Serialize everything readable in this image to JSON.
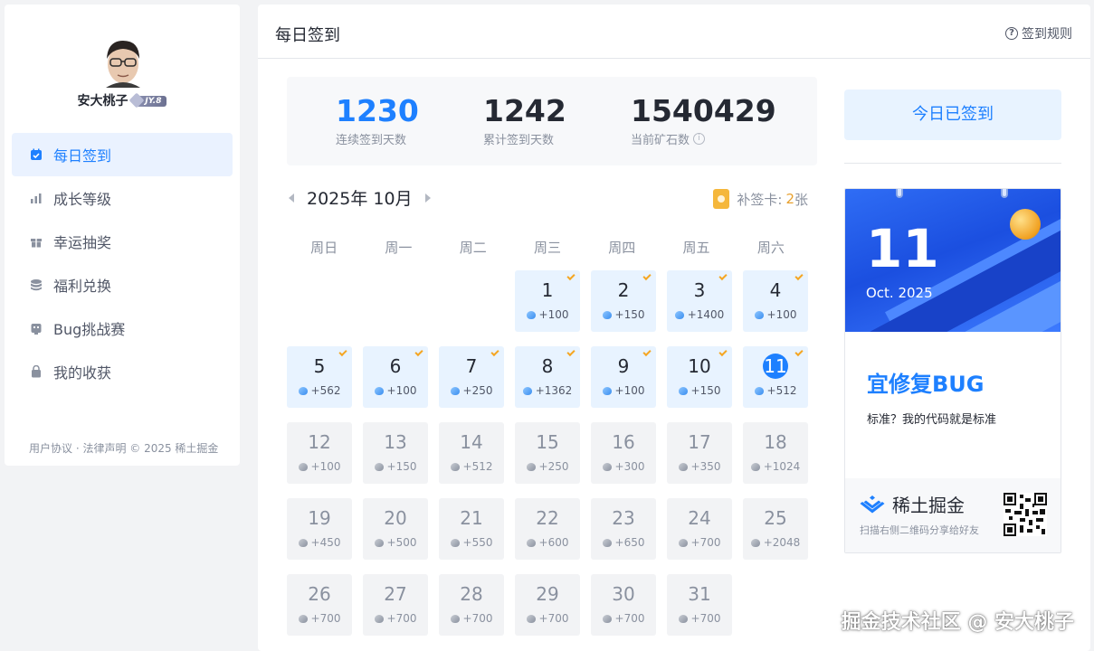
{
  "user": {
    "name": "安大桃子",
    "level": "JY.8"
  },
  "nav": [
    {
      "label": "每日签到",
      "icon": "calendar-check-icon",
      "active": true
    },
    {
      "label": "成长等级",
      "icon": "bar-chart-icon",
      "active": false
    },
    {
      "label": "幸运抽奖",
      "icon": "gift-icon",
      "active": false
    },
    {
      "label": "福利兑换",
      "icon": "coins-icon",
      "active": false
    },
    {
      "label": "Bug挑战赛",
      "icon": "bug-icon",
      "active": false
    },
    {
      "label": "我的收获",
      "icon": "bag-icon",
      "active": false
    }
  ],
  "footer": "用户协议 · 法律声明 © 2025 稀土掘金",
  "header": {
    "title": "每日签到",
    "rules": "签到规则"
  },
  "stats": [
    {
      "value": "1230",
      "label": "连续签到天数"
    },
    {
      "value": "1242",
      "label": "累计签到天数"
    },
    {
      "value": "1540429",
      "label": "当前矿石数"
    }
  ],
  "calendar": {
    "month_label": "2025年 10月",
    "makeup_label": "补签卡:",
    "makeup_count": "2",
    "makeup_unit": "张",
    "weekdays": [
      "周日",
      "周一",
      "周二",
      "周三",
      "周四",
      "周五",
      "周六"
    ],
    "first_weekday": 3,
    "today": 11,
    "days": [
      {
        "d": "1",
        "p": "+100",
        "s": "signed"
      },
      {
        "d": "2",
        "p": "+150",
        "s": "signed"
      },
      {
        "d": "3",
        "p": "+1400",
        "s": "signed"
      },
      {
        "d": "4",
        "p": "+100",
        "s": "signed"
      },
      {
        "d": "5",
        "p": "+562",
        "s": "signed"
      },
      {
        "d": "6",
        "p": "+100",
        "s": "signed"
      },
      {
        "d": "7",
        "p": "+250",
        "s": "signed"
      },
      {
        "d": "8",
        "p": "+1362",
        "s": "signed"
      },
      {
        "d": "9",
        "p": "+100",
        "s": "signed"
      },
      {
        "d": "10",
        "p": "+150",
        "s": "signed"
      },
      {
        "d": "11",
        "p": "+512",
        "s": "today"
      },
      {
        "d": "12",
        "p": "+100",
        "s": "future"
      },
      {
        "d": "13",
        "p": "+150",
        "s": "future"
      },
      {
        "d": "14",
        "p": "+512",
        "s": "future"
      },
      {
        "d": "15",
        "p": "+250",
        "s": "future"
      },
      {
        "d": "16",
        "p": "+300",
        "s": "future"
      },
      {
        "d": "17",
        "p": "+350",
        "s": "future"
      },
      {
        "d": "18",
        "p": "+1024",
        "s": "future"
      },
      {
        "d": "19",
        "p": "+450",
        "s": "future"
      },
      {
        "d": "20",
        "p": "+500",
        "s": "future"
      },
      {
        "d": "21",
        "p": "+550",
        "s": "future"
      },
      {
        "d": "22",
        "p": "+600",
        "s": "future"
      },
      {
        "d": "23",
        "p": "+650",
        "s": "future"
      },
      {
        "d": "24",
        "p": "+700",
        "s": "future"
      },
      {
        "d": "25",
        "p": "+2048",
        "s": "future"
      },
      {
        "d": "26",
        "p": "+700",
        "s": "future"
      },
      {
        "d": "27",
        "p": "+700",
        "s": "future"
      },
      {
        "d": "28",
        "p": "+700",
        "s": "future"
      },
      {
        "d": "29",
        "p": "+700",
        "s": "future"
      },
      {
        "d": "30",
        "p": "+700",
        "s": "future"
      },
      {
        "d": "31",
        "p": "+700",
        "s": "future"
      }
    ]
  },
  "sign_button": "今日已签到",
  "promo": {
    "day": "11",
    "month": "Oct. 2025",
    "fortune": "宜修复BUG",
    "fortune_sub": "标准？我的代码就是标准",
    "brand": "稀土掘金",
    "brand_sub": "扫描右侧二维码分享给好友"
  },
  "watermark": "掘金技术社区 @ 安大桃子",
  "colors": {
    "accent": "#1e80ff",
    "signed_bg": "#e8f3ff",
    "future_bg": "#f2f3f5",
    "check": "#f5a623"
  }
}
